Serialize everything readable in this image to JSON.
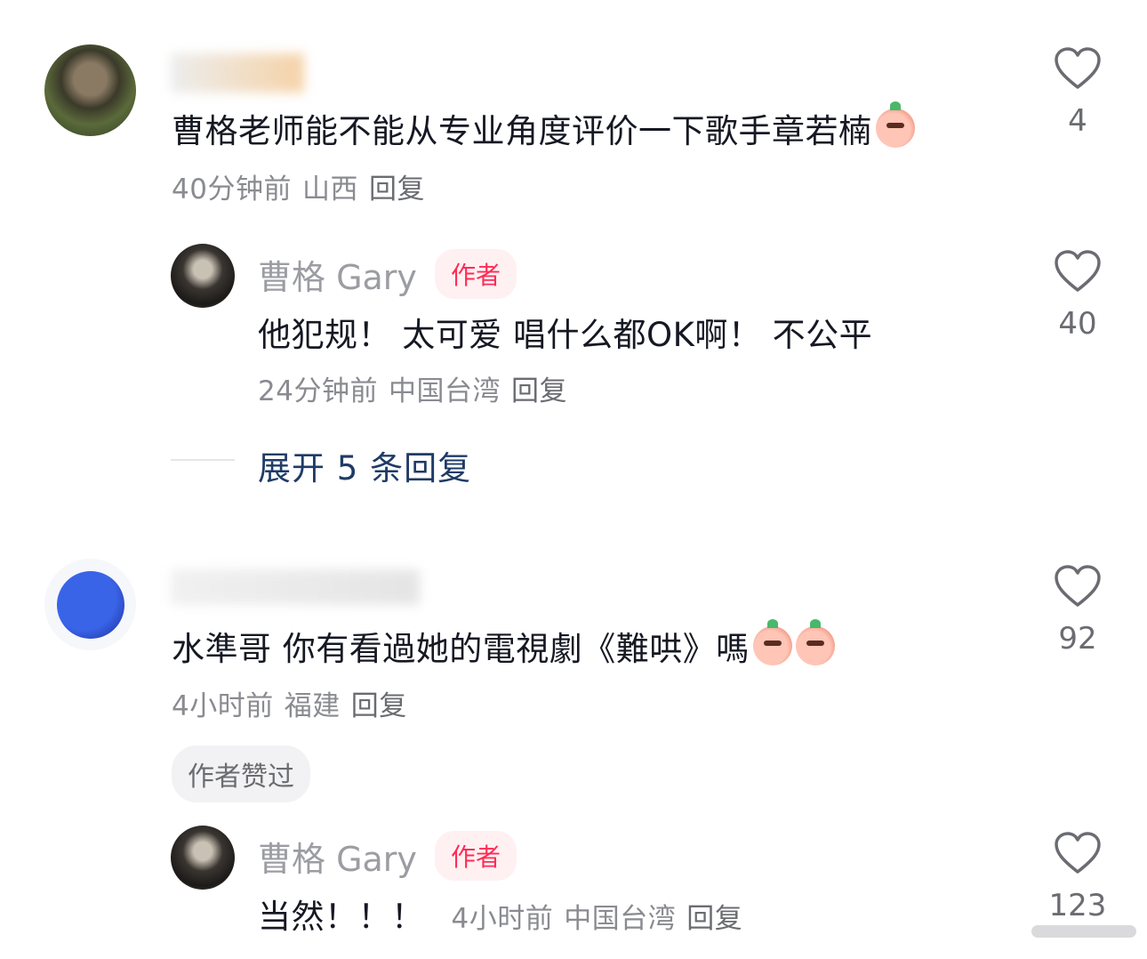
{
  "comments": [
    {
      "text": "曹格老师能不能从专业角度评价一下歌手章若楠",
      "emoji": "emoji-blush",
      "time": "40分钟前",
      "location": "山西",
      "reply_label": "回复",
      "likes": "4"
    },
    {
      "author": "曹格 Gary",
      "badge": "作者",
      "text": "他犯规！ 太可爱 唱什么都OK啊！ 不公平",
      "time": "24分钟前",
      "location": "中国台湾",
      "reply_label": "回复",
      "likes": "40"
    },
    {
      "text": "水準哥 你有看過她的電視劇《難哄》嗎",
      "emojis": [
        "emoji-laugh",
        "emoji-blush"
      ],
      "time": "4小时前",
      "location": "福建",
      "reply_label": "回复",
      "likes": "92",
      "liked_by_author": "作者赞过"
    },
    {
      "author": "曹格 Gary",
      "badge": "作者",
      "text": "当然！！！",
      "time": "4小时前",
      "location": "中国台湾",
      "reply_label": "回复",
      "likes": "123"
    }
  ],
  "expand_replies": "展开 5 条回复",
  "colors": {
    "text": "#161823",
    "meta": "#8a8b91",
    "author_badge": "#fe2c55",
    "expand": "#1f3b66"
  }
}
